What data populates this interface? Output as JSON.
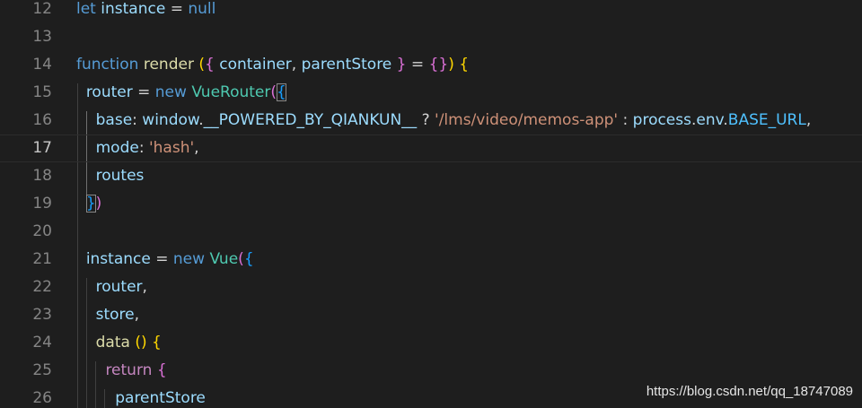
{
  "editor": {
    "lines": [
      {
        "n": "12",
        "tokens": [
          [
            "kw",
            "let"
          ],
          [
            "pun",
            " "
          ],
          [
            "var",
            "instance"
          ],
          [
            "pun",
            " = "
          ],
          [
            "kw",
            "null"
          ]
        ]
      },
      {
        "n": "13",
        "tokens": []
      },
      {
        "n": "14",
        "tokens": [
          [
            "kw",
            "function"
          ],
          [
            "pun",
            " "
          ],
          [
            "fn",
            "render"
          ],
          [
            "pun",
            " "
          ],
          [
            "b1",
            "("
          ],
          [
            "b2",
            "{"
          ],
          [
            "pun",
            " "
          ],
          [
            "var",
            "container"
          ],
          [
            "pun",
            ", "
          ],
          [
            "var",
            "parentStore"
          ],
          [
            "pun",
            " "
          ],
          [
            "b2",
            "}"
          ],
          [
            "pun",
            " = "
          ],
          [
            "b2",
            "{}"
          ],
          [
            "b1",
            ")"
          ],
          [
            "pun",
            " "
          ],
          [
            "b1",
            "{"
          ]
        ]
      },
      {
        "n": "15",
        "tokens": [
          [
            "pun",
            "  "
          ],
          [
            "var",
            "router"
          ],
          [
            "pun",
            " = "
          ],
          [
            "kw",
            "new"
          ],
          [
            "pun",
            " "
          ],
          [
            "cls",
            "VueRouter"
          ],
          [
            "b2",
            "("
          ],
          [
            "b3bm",
            "{"
          ]
        ]
      },
      {
        "n": "16",
        "tokens": [
          [
            "pun",
            "    "
          ],
          [
            "var",
            "base"
          ],
          [
            "pun",
            ": "
          ],
          [
            "var",
            "window"
          ],
          [
            "pun",
            "."
          ],
          [
            "var",
            "__POWERED_BY_QIANKUN__"
          ],
          [
            "pun",
            " ? "
          ],
          [
            "str",
            "'/lms/video/memos-app'"
          ],
          [
            "pun",
            " : "
          ],
          [
            "var",
            "process"
          ],
          [
            "pun",
            "."
          ],
          [
            "var",
            "env"
          ],
          [
            "pun",
            "."
          ],
          [
            "const",
            "BASE_URL"
          ],
          [
            "pun",
            ","
          ]
        ]
      },
      {
        "n": "17",
        "tokens": [
          [
            "pun",
            "    "
          ],
          [
            "var",
            "mode"
          ],
          [
            "pun",
            ": "
          ],
          [
            "str",
            "'hash'"
          ],
          [
            "pun",
            ","
          ]
        ],
        "current": true
      },
      {
        "n": "18",
        "tokens": [
          [
            "pun",
            "    "
          ],
          [
            "var",
            "routes"
          ]
        ]
      },
      {
        "n": "19",
        "tokens": [
          [
            "pun",
            "  "
          ],
          [
            "b3bm",
            "}"
          ],
          [
            "b2",
            ")"
          ]
        ]
      },
      {
        "n": "20",
        "tokens": []
      },
      {
        "n": "21",
        "tokens": [
          [
            "pun",
            "  "
          ],
          [
            "var",
            "instance"
          ],
          [
            "pun",
            " = "
          ],
          [
            "kw",
            "new"
          ],
          [
            "pun",
            " "
          ],
          [
            "cls",
            "Vue"
          ],
          [
            "b2",
            "("
          ],
          [
            "b3",
            "{"
          ]
        ]
      },
      {
        "n": "22",
        "tokens": [
          [
            "pun",
            "    "
          ],
          [
            "var",
            "router"
          ],
          [
            "pun",
            ","
          ]
        ]
      },
      {
        "n": "23",
        "tokens": [
          [
            "pun",
            "    "
          ],
          [
            "var",
            "store"
          ],
          [
            "pun",
            ","
          ]
        ]
      },
      {
        "n": "24",
        "tokens": [
          [
            "pun",
            "    "
          ],
          [
            "fn",
            "data"
          ],
          [
            "pun",
            " "
          ],
          [
            "b1",
            "()"
          ],
          [
            "pun",
            " "
          ],
          [
            "b1",
            "{"
          ]
        ]
      },
      {
        "n": "25",
        "tokens": [
          [
            "pun",
            "      "
          ],
          [
            "kw2",
            "return"
          ],
          [
            "pun",
            " "
          ],
          [
            "b2",
            "{"
          ]
        ]
      },
      {
        "n": "26",
        "tokens": [
          [
            "pun",
            "        "
          ],
          [
            "var",
            "parentStore"
          ]
        ]
      }
    ]
  },
  "watermark": {
    "text": "https://blog.csdn.net/qq_18747089"
  },
  "colors": {
    "background": "#1e1e1e",
    "keyword": "#569cd6",
    "control_keyword": "#c586c0",
    "variable": "#9cdcfe",
    "function": "#dcdcaa",
    "class": "#4ec9b0",
    "string": "#ce9178",
    "constant": "#4fc1ff",
    "line_number": "#858585"
  }
}
